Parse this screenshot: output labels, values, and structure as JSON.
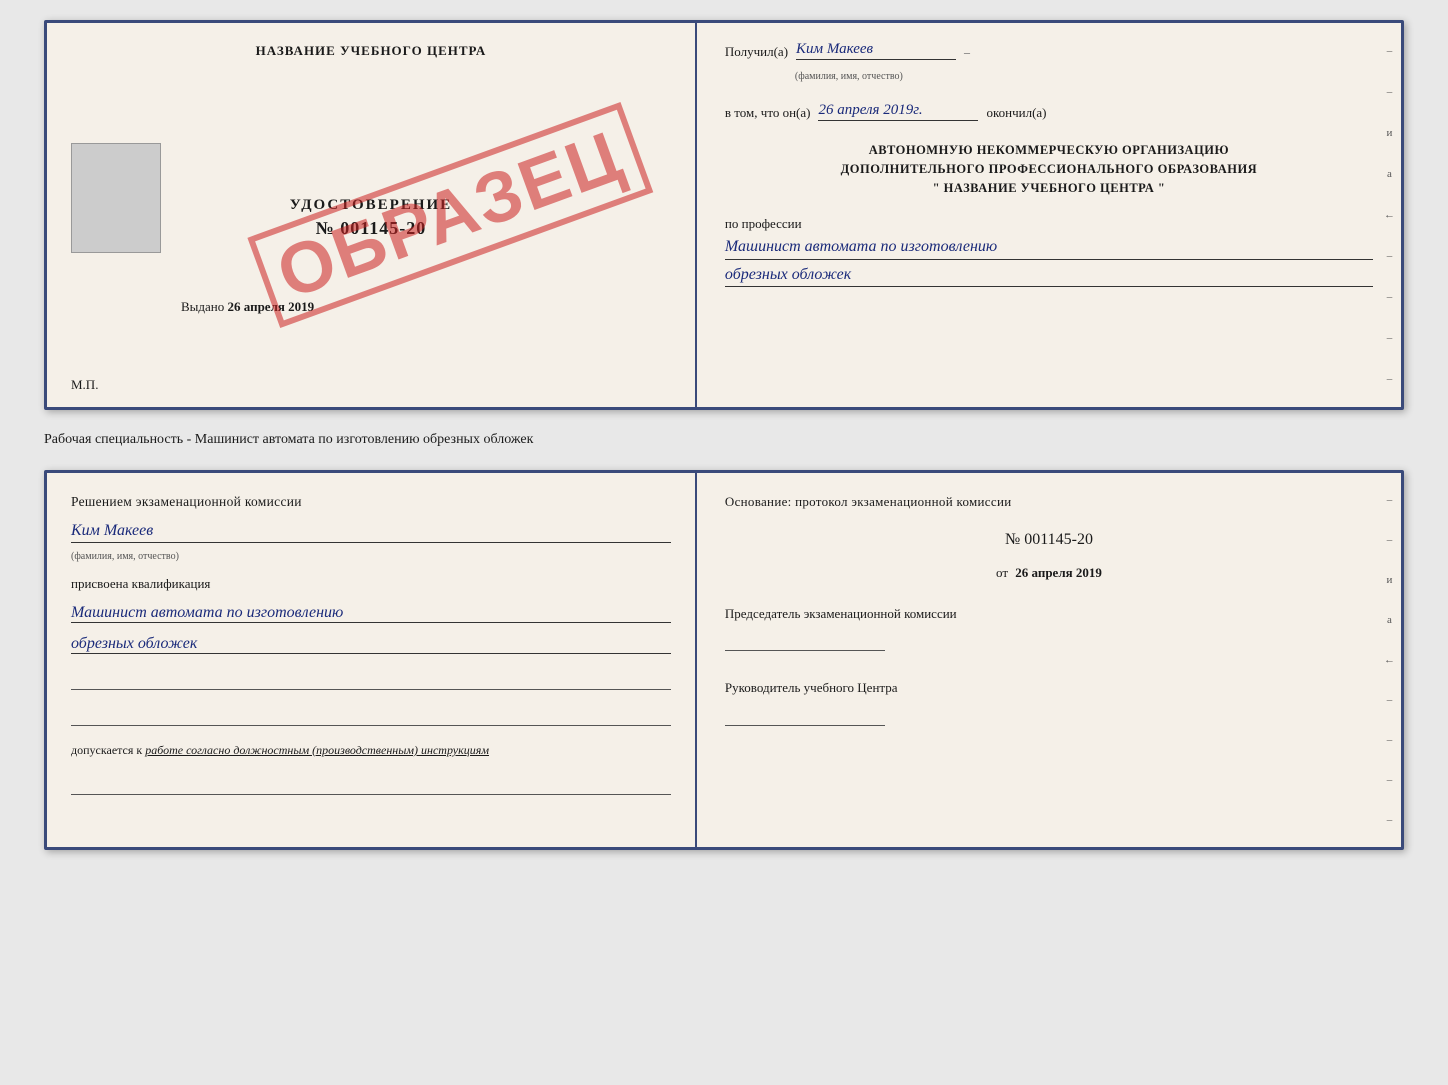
{
  "top_document": {
    "left": {
      "school_name": "НАЗВАНИЕ УЧЕБНОГО ЦЕНТРА",
      "cert_label": "УДОСТОВЕРЕНИЕ",
      "cert_number": "№ 001145-20",
      "issued_prefix": "Выдано",
      "issued_date": "26 апреля 2019",
      "mp_label": "М.П.",
      "stamp_text": "ОБРАЗЕЦ"
    },
    "right": {
      "received_prefix": "Получил(а)",
      "received_name": "Ким Макеев",
      "name_sub": "(фамилия, имя, отчество)",
      "date_prefix": "в том, что он(а)",
      "date_value": "26 апреля 2019г.",
      "finished_label": "окончил(а)",
      "org_line1": "АВТОНОМНУЮ НЕКОММЕРЧЕСКУЮ ОРГАНИЗАЦИЮ",
      "org_line2": "ДОПОЛНИТЕЛЬНОГО ПРОФЕССИОНАЛЬНОГО ОБРАЗОВАНИЯ",
      "org_line3": "\"  НАЗВАНИЕ УЧЕБНОГО ЦЕНТРА  \"",
      "profession_prefix": "по профессии",
      "profession_line1": "Машинист автомата по изготовлению",
      "profession_line2": "обрезных обложек"
    }
  },
  "separator": {
    "text": "Рабочая специальность - Машинист автомата по изготовлению обрезных обложек"
  },
  "bottom_document": {
    "left": {
      "decision_text": "Решением экзаменационной комиссии",
      "person_name": "Ким Макеев",
      "name_sub": "(фамилия, имя, отчество)",
      "qualification_prefix": "присвоена квалификация",
      "qualification_line1": "Машинист автомата по изготовлению",
      "qualification_line2": "обрезных обложек",
      "admission_prefix": "допускается к",
      "admission_italic": "работе согласно должностным (производственным) инструкциям"
    },
    "right": {
      "basis_text": "Основание: протокол экзаменационной комиссии",
      "protocol_number": "№  001145-20",
      "date_prefix": "от",
      "date_value": "26 апреля 2019",
      "chairman_label": "Председатель экзаменационной комиссии",
      "head_label": "Руководитель учебного Центра"
    }
  },
  "dashes": {
    "marks": [
      "-",
      "-",
      "и",
      "а",
      "←",
      "-",
      "-",
      "-",
      "-"
    ]
  }
}
